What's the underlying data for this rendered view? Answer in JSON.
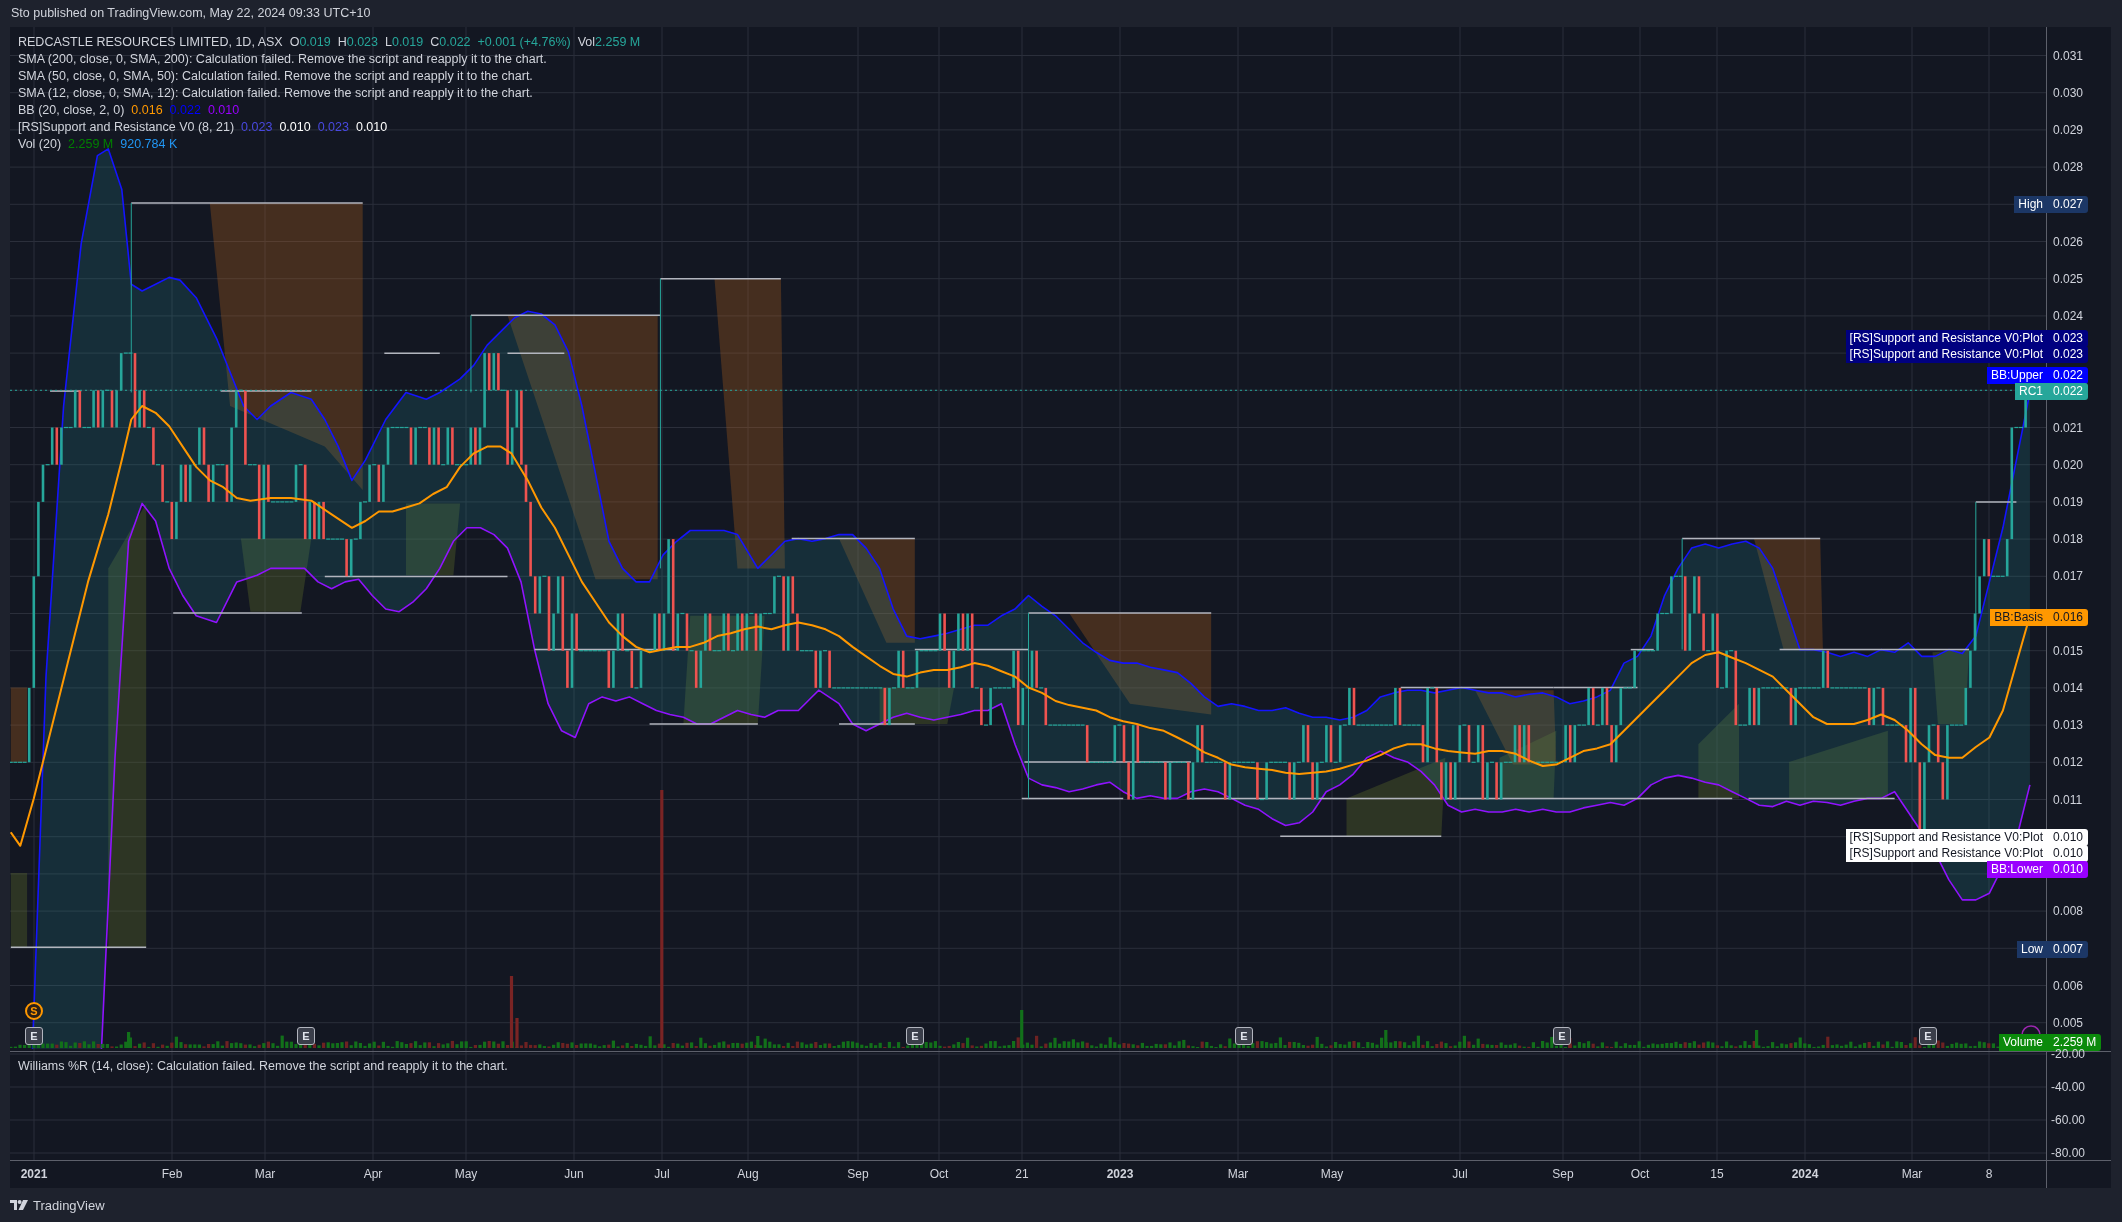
{
  "header": {
    "text": "Sto published on TradingView.com, May 22, 2024 09:33 UTC+10"
  },
  "legend": {
    "symbol": "REDCASTLE RESOURCES LIMITED, 1D, ASX",
    "ohlc": [
      {
        "label": "O",
        "value": "0.019"
      },
      {
        "label": "H",
        "value": "0.023"
      },
      {
        "label": "L",
        "value": "0.019"
      },
      {
        "label": "C",
        "value": "0.022"
      }
    ],
    "change": "+0.001 (+4.76%)",
    "volume_label": "Vol",
    "volume_value": "2.259 M",
    "indicators": [
      {
        "kind": "error",
        "text": "SMA (200, close, 0, SMA, 200): Calculation failed. Remove the script and reapply it to the chart."
      },
      {
        "kind": "error",
        "text": "SMA (50, close, 0, SMA, 50): Calculation failed. Remove the script and reapply it to the chart."
      },
      {
        "kind": "error",
        "text": "SMA (12, close, 0, SMA, 12): Calculation failed. Remove the script and reapply it to the chart."
      },
      {
        "kind": "values",
        "name": "BB (20, close, 2, 0)",
        "values": [
          {
            "text": "0.016",
            "color": "#ff9800"
          },
          {
            "text": "0.022",
            "color": "#0000ff"
          },
          {
            "text": "0.010",
            "color": "#9900ff"
          }
        ]
      },
      {
        "kind": "values",
        "name": "[RS]Support and Resistance V0 (8, 21)",
        "values": [
          {
            "text": "0.023",
            "color": "#4848e0"
          },
          {
            "text": "0.010",
            "color": "#ffffff"
          },
          {
            "text": "0.023",
            "color": "#4848e0"
          },
          {
            "text": "0.010",
            "color": "#ffffff"
          }
        ]
      },
      {
        "kind": "values",
        "name": "Vol (20)",
        "values": [
          {
            "text": "2.259 M",
            "color": "#008000"
          },
          {
            "text": "920.784 K",
            "color": "#2196f3"
          }
        ]
      }
    ]
  },
  "price_axis": {
    "ticks": [
      "0.031",
      "0.030",
      "0.029",
      "0.028",
      "0.026",
      "0.025",
      "0.024",
      "0.021",
      "0.020",
      "0.019",
      "0.018",
      "0.017",
      "0.015",
      "0.014",
      "0.013",
      "0.012",
      "0.011",
      "0.008",
      "0.006",
      "0.005"
    ]
  },
  "price_labels": [
    {
      "title": "High",
      "value": "0.027",
      "color": "#1c3766"
    },
    {
      "title": "[RS]Support and Resistance V0:Plot",
      "value": "0.023",
      "color": "#000080"
    },
    {
      "title": "[RS]Support and Resistance V0:Plot",
      "value": "0.023",
      "color": "#000080"
    },
    {
      "title": "BB:Upper",
      "value": "0.022",
      "color": "#0000ff"
    },
    {
      "title": "RC1",
      "value": "0.022",
      "color": "#26a69a"
    },
    {
      "title": "BB:Basis",
      "value": "0.016",
      "color": "#ff9800"
    },
    {
      "title": "[RS]Support and Resistance V0:Plot",
      "value": "0.010",
      "color": "#ffffff"
    },
    {
      "title": "[RS]Support and Resistance V0:Plot",
      "value": "0.010",
      "color": "#ffffff"
    },
    {
      "title": "BB:Lower",
      "value": "0.010",
      "color": "#9900ff"
    },
    {
      "title": "Low",
      "value": "0.007",
      "color": "#1c3766"
    },
    {
      "title": "Volume",
      "value": "2.259 M",
      "color": "#0b8a0b"
    }
  ],
  "events": [
    {
      "kind": "split",
      "label": "S"
    },
    {
      "kind": "earnings",
      "label": "E"
    },
    {
      "kind": "earnings",
      "label": "E"
    },
    {
      "kind": "earnings",
      "label": "E"
    },
    {
      "kind": "earnings",
      "label": "E"
    },
    {
      "kind": "earnings",
      "label": "E"
    },
    {
      "kind": "earnings",
      "label": "E"
    }
  ],
  "williams_pane": {
    "title": "Williams %R (14, close): Calculation failed. Remove the script and reapply it to the chart.",
    "ticks": [
      "-20.00",
      "-40.00",
      "-60.00",
      "-80.00"
    ]
  },
  "time_axis": [
    {
      "label": "2021",
      "kind": "year"
    },
    {
      "label": "Feb",
      "kind": "month"
    },
    {
      "label": "Mar",
      "kind": "month"
    },
    {
      "label": "Apr",
      "kind": "month"
    },
    {
      "label": "May",
      "kind": "month"
    },
    {
      "label": "Jun",
      "kind": "month"
    },
    {
      "label": "Jul",
      "kind": "month"
    },
    {
      "label": "Aug",
      "kind": "month"
    },
    {
      "label": "Sep",
      "kind": "month"
    },
    {
      "label": "Oct",
      "kind": "month"
    },
    {
      "label": "21",
      "kind": "day"
    },
    {
      "label": "2023",
      "kind": "year"
    },
    {
      "label": "Mar",
      "kind": "month"
    },
    {
      "label": "May",
      "kind": "month"
    },
    {
      "label": "Jul",
      "kind": "month"
    },
    {
      "label": "Sep",
      "kind": "month"
    },
    {
      "label": "Oct",
      "kind": "month"
    },
    {
      "label": "15",
      "kind": "day"
    },
    {
      "label": "2024",
      "kind": "year"
    },
    {
      "label": "Mar",
      "kind": "month"
    },
    {
      "label": "8",
      "kind": "day"
    }
  ],
  "footer": {
    "brand": "TradingView"
  }
}
